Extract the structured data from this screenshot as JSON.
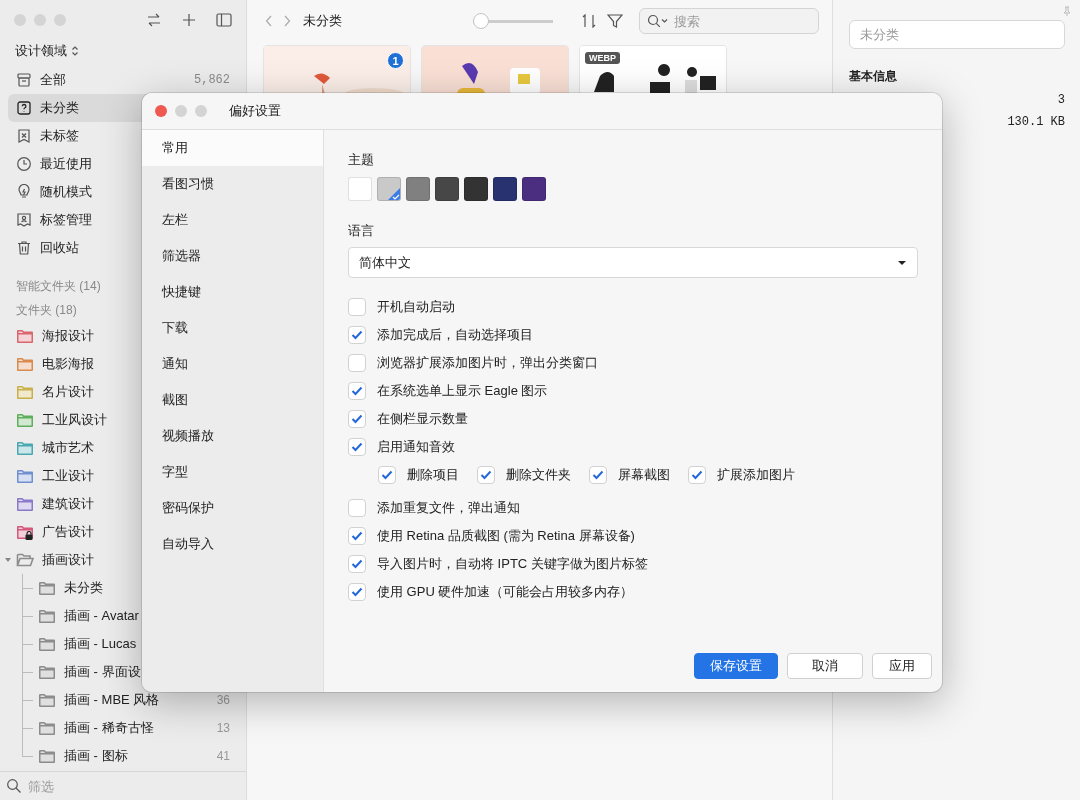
{
  "sidebar": {
    "library": "设计领域",
    "nav": [
      {
        "label": "全部",
        "count": "5,862",
        "selected": false
      },
      {
        "label": "未分类",
        "selected": true
      },
      {
        "label": "未标签",
        "selected": false
      },
      {
        "label": "最近使用",
        "selected": false
      },
      {
        "label": "随机模式",
        "selected": false
      },
      {
        "label": "标签管理",
        "selected": false
      },
      {
        "label": "回收站",
        "selected": false
      }
    ],
    "smart_folders_header": "智能文件夹 (14)",
    "folders_header": "文件夹 (18)",
    "folders": [
      {
        "label": "海报设计",
        "color": "#d9656f",
        "locked": false
      },
      {
        "label": "电影海报",
        "color": "#d98a4e",
        "locked": false
      },
      {
        "label": "名片设计",
        "color": "#c9b04a",
        "locked": false
      },
      {
        "label": "工业风设计",
        "color": "#5fae5c",
        "locked": false
      },
      {
        "label": "城市艺术",
        "color": "#4aa8b0",
        "locked": false
      },
      {
        "label": "工业设计",
        "color": "#6f8fd0",
        "locked": false
      },
      {
        "label": "建筑设计",
        "color": "#8a78c9",
        "locked": false
      },
      {
        "label": "广告设计",
        "color": "#d4587a",
        "locked": true
      },
      {
        "label": "插画设计",
        "color": "#8c8c8c",
        "locked": false,
        "expanded": true,
        "children": [
          {
            "label": "未分类"
          },
          {
            "label": "插画 - Avatar"
          },
          {
            "label": "插画 - Lucas"
          },
          {
            "label": "插画 - 界面设"
          },
          {
            "label": "插画 - MBE 风格",
            "count": "36"
          },
          {
            "label": "插画 - 稀奇古怪",
            "count": "13"
          },
          {
            "label": "插画 - 图标",
            "count": "41"
          }
        ]
      }
    ],
    "filter": {
      "placeholder": "筛选"
    }
  },
  "browser": {
    "title": "未分类",
    "zoom": {
      "level": 0.1
    },
    "search": {
      "placeholder": "搜索"
    },
    "items": [
      {
        "kind": "picture",
        "badge": "1"
      },
      {
        "kind": "picture"
      },
      {
        "kind": "picture",
        "format": "WEBP"
      }
    ]
  },
  "inspector": {
    "name": {
      "placeholder": "未分类"
    },
    "section": "基本信息",
    "values": [
      "3",
      "130.1 KB"
    ]
  },
  "dialog": {
    "title": "偏好设置",
    "nav": [
      {
        "label": "常用",
        "selected": true
      },
      {
        "label": "看图习惯",
        "selected": false
      },
      {
        "label": "左栏",
        "selected": false
      },
      {
        "label": "筛选器",
        "selected": false
      },
      {
        "label": "快捷键",
        "selected": false
      },
      {
        "label": "下载",
        "selected": false
      },
      {
        "label": "通知",
        "selected": false
      },
      {
        "label": "截图",
        "selected": false
      },
      {
        "label": "视频播放",
        "selected": false
      },
      {
        "label": "字型",
        "selected": false
      },
      {
        "label": "密码保护",
        "selected": false
      },
      {
        "label": "自动导入",
        "selected": false
      }
    ],
    "theme": {
      "label": "主题",
      "swatches": [
        {
          "color": "#ffffff",
          "selected": false
        },
        {
          "color": "#c9c9c9",
          "selected": true
        },
        {
          "color": "#808080",
          "selected": false
        },
        {
          "color": "#474747",
          "selected": false
        },
        {
          "color": "#333333",
          "selected": false
        },
        {
          "color": "#283270",
          "selected": false
        },
        {
          "color": "#4b2e80",
          "selected": false
        }
      ]
    },
    "language": {
      "label": "语言",
      "value": "简体中文"
    },
    "options": [
      {
        "label": "开机自动启动",
        "checked": false
      },
      {
        "label": "添加完成后，自动选择项目",
        "checked": true
      },
      {
        "label": "浏览器扩展添加图片时，弹出分类窗口",
        "checked": false
      },
      {
        "label": "在系统选单上显示 Eagle 图示",
        "checked": true
      },
      {
        "label": "在侧栏显示数量",
        "checked": true
      },
      {
        "label": "启用通知音效",
        "checked": true,
        "children": [
          {
            "label": "删除项目",
            "checked": true
          },
          {
            "label": "删除文件夹",
            "checked": true
          },
          {
            "label": "屏幕截图",
            "checked": true
          },
          {
            "label": "扩展添加图片",
            "checked": true
          }
        ]
      },
      {
        "label": "添加重复文件，弹出通知",
        "checked": false
      },
      {
        "label": "使用 Retina 品质截图 (需为 Retina 屏幕设备)",
        "checked": true
      },
      {
        "label": "导入图片时，自动将 IPTC 关键字做为图片标签",
        "checked": true
      },
      {
        "label": "使用 GPU 硬件加速（可能会占用较多内存）",
        "checked": true
      }
    ],
    "buttons": [
      {
        "label": "保存设置",
        "kind": "primary"
      },
      {
        "label": "取消",
        "kind": "default"
      },
      {
        "label": "应用",
        "kind": "default"
      }
    ]
  }
}
